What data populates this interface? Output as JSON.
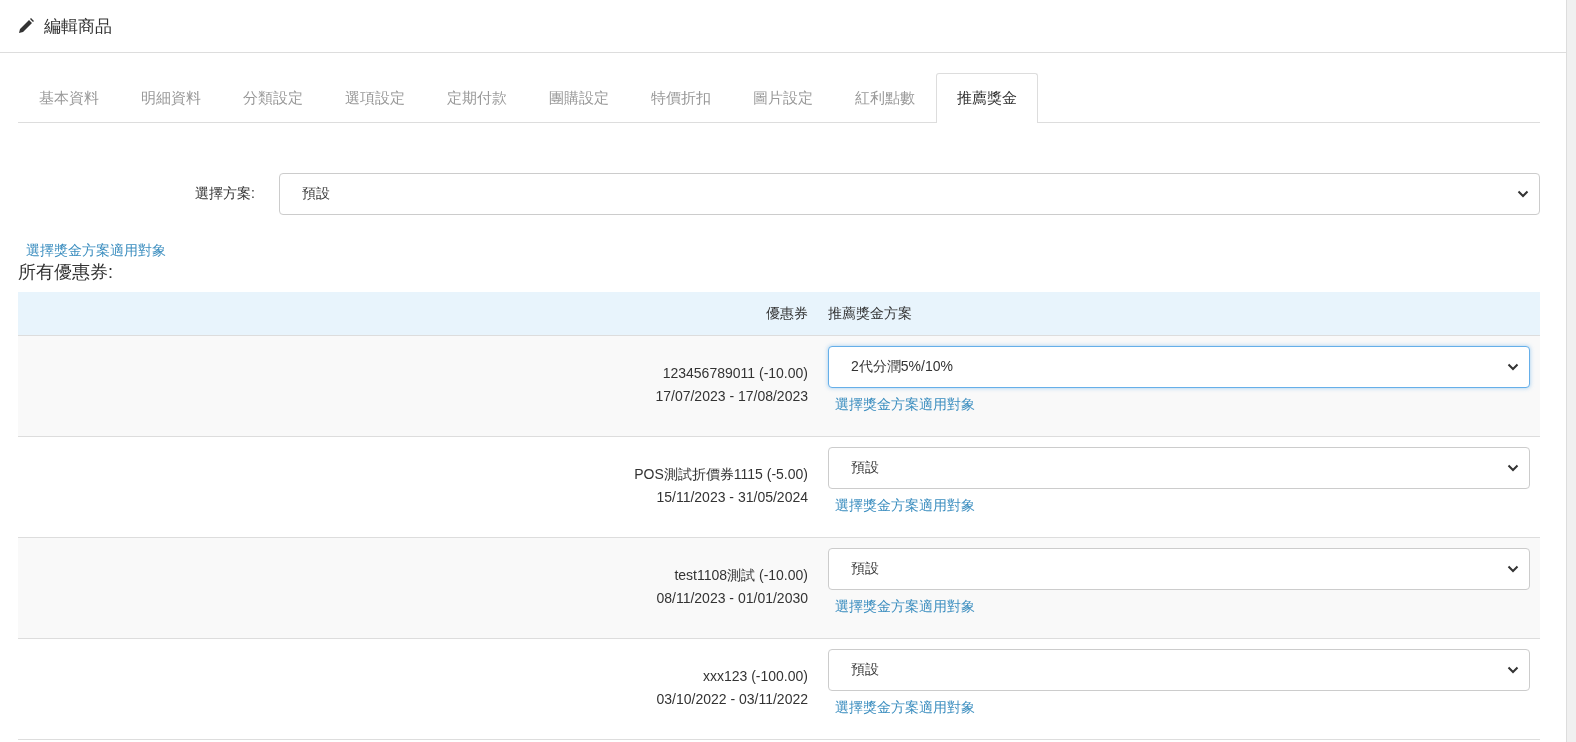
{
  "header": {
    "title": "編輯商品"
  },
  "tabs": [
    {
      "label": "基本資料",
      "selected": false
    },
    {
      "label": "明細資料",
      "selected": false
    },
    {
      "label": "分類設定",
      "selected": false
    },
    {
      "label": "選項設定",
      "selected": false
    },
    {
      "label": "定期付款",
      "selected": false
    },
    {
      "label": "團購設定",
      "selected": false
    },
    {
      "label": "特價折扣",
      "selected": false
    },
    {
      "label": "圖片設定",
      "selected": false
    },
    {
      "label": "紅利點數",
      "selected": false
    },
    {
      "label": "推薦獎金",
      "selected": true
    }
  ],
  "plan": {
    "label": "選擇方案:",
    "value": "預設",
    "link": "選擇獎金方案適用對象"
  },
  "coupons": {
    "heading": "所有優惠券:",
    "columns": [
      "優惠券",
      "推薦獎金方案"
    ],
    "rows": [
      {
        "name": "123456789011 (-10.00)",
        "dates": "17/07/2023 - 17/08/2023",
        "plan": "2代分潤5%/10%",
        "focused": true,
        "link": "選擇獎金方案適用對象"
      },
      {
        "name": "POS測試折價券1115 (-5.00)",
        "dates": "15/11/2023 - 31/05/2024",
        "plan": "預設",
        "focused": false,
        "link": "選擇獎金方案適用對象"
      },
      {
        "name": "test1108測試 (-10.00)",
        "dates": "08/11/2023 - 01/01/2030",
        "plan": "預設",
        "focused": false,
        "link": "選擇獎金方案適用對象"
      },
      {
        "name": "xxx123 (-100.00)",
        "dates": "03/10/2022 - 03/11/2022",
        "plan": "預設",
        "focused": false,
        "link": "選擇獎金方案適用對象"
      }
    ]
  }
}
